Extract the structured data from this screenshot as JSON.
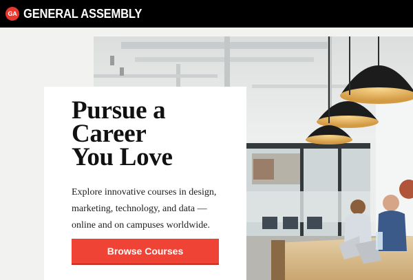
{
  "brand": {
    "badge": "GA",
    "name": "GENERAL ASSEMBLY",
    "accent_color": "#ef4335"
  },
  "hero": {
    "headline_lines": [
      "Pursue a",
      "Career",
      "You Love"
    ],
    "description_lines": [
      "Explore innovative courses in design,",
      "marketing, technology, and data —",
      "online and on campuses worldwide."
    ],
    "cta_label": "Browse Courses",
    "image_icon": "office-photo"
  }
}
